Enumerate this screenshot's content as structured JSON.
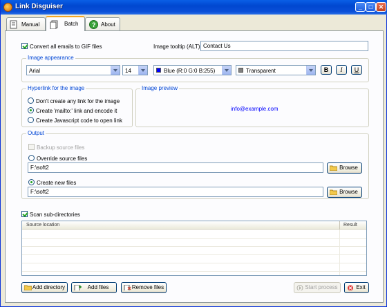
{
  "app": {
    "title": "Link Disguiser"
  },
  "window_controls": {
    "minimize": "_",
    "maximize": "□",
    "close": "✕"
  },
  "tabs": [
    {
      "label": "Manual",
      "icon": "manual-icon"
    },
    {
      "label": "Batch",
      "icon": "batch-icon",
      "active": true
    },
    {
      "label": "About",
      "icon": "help-icon"
    }
  ],
  "convert": {
    "label": "Convert all emails to GIF files",
    "checked": true
  },
  "tooltip": {
    "label": "Image tooltip (ALT):",
    "value": "Contact Us"
  },
  "appearance": {
    "title": "Image appearance",
    "font": "Arial",
    "size": "14",
    "text_color": {
      "label": "Blue (R:0 G:0 B:255)",
      "hex": "#0000ff"
    },
    "background": {
      "label": "Transparent",
      "hex": "#808080"
    },
    "bold": "B",
    "italic": "I",
    "underline": "U"
  },
  "hyperlink": {
    "title": "Hyperlink for the image",
    "options": [
      {
        "label": "Don't create any link for the image",
        "selected": false
      },
      {
        "label": "Create 'mailto:' link and encode it",
        "selected": true
      },
      {
        "label": "Create Javascript code to open link",
        "selected": false
      }
    ]
  },
  "preview": {
    "title": "Image preview",
    "sample": "info@example.com",
    "color": "#0000ff"
  },
  "output": {
    "title": "Output",
    "backup": "Backup source files",
    "override": {
      "label": "Override source files",
      "path": "F:\\soft2"
    },
    "create_new": {
      "label": "Create new files",
      "path": "F:\\soft2"
    },
    "browse": "Browse"
  },
  "scan": {
    "label": "Scan sub-directories",
    "checked": true
  },
  "table": {
    "col_source": "Source location",
    "col_result": "Result"
  },
  "buttons": {
    "add_directory": "Add directory",
    "add_files": "Add files",
    "remove_files": "Remove files",
    "start": "Start process",
    "exit": "Exit"
  }
}
